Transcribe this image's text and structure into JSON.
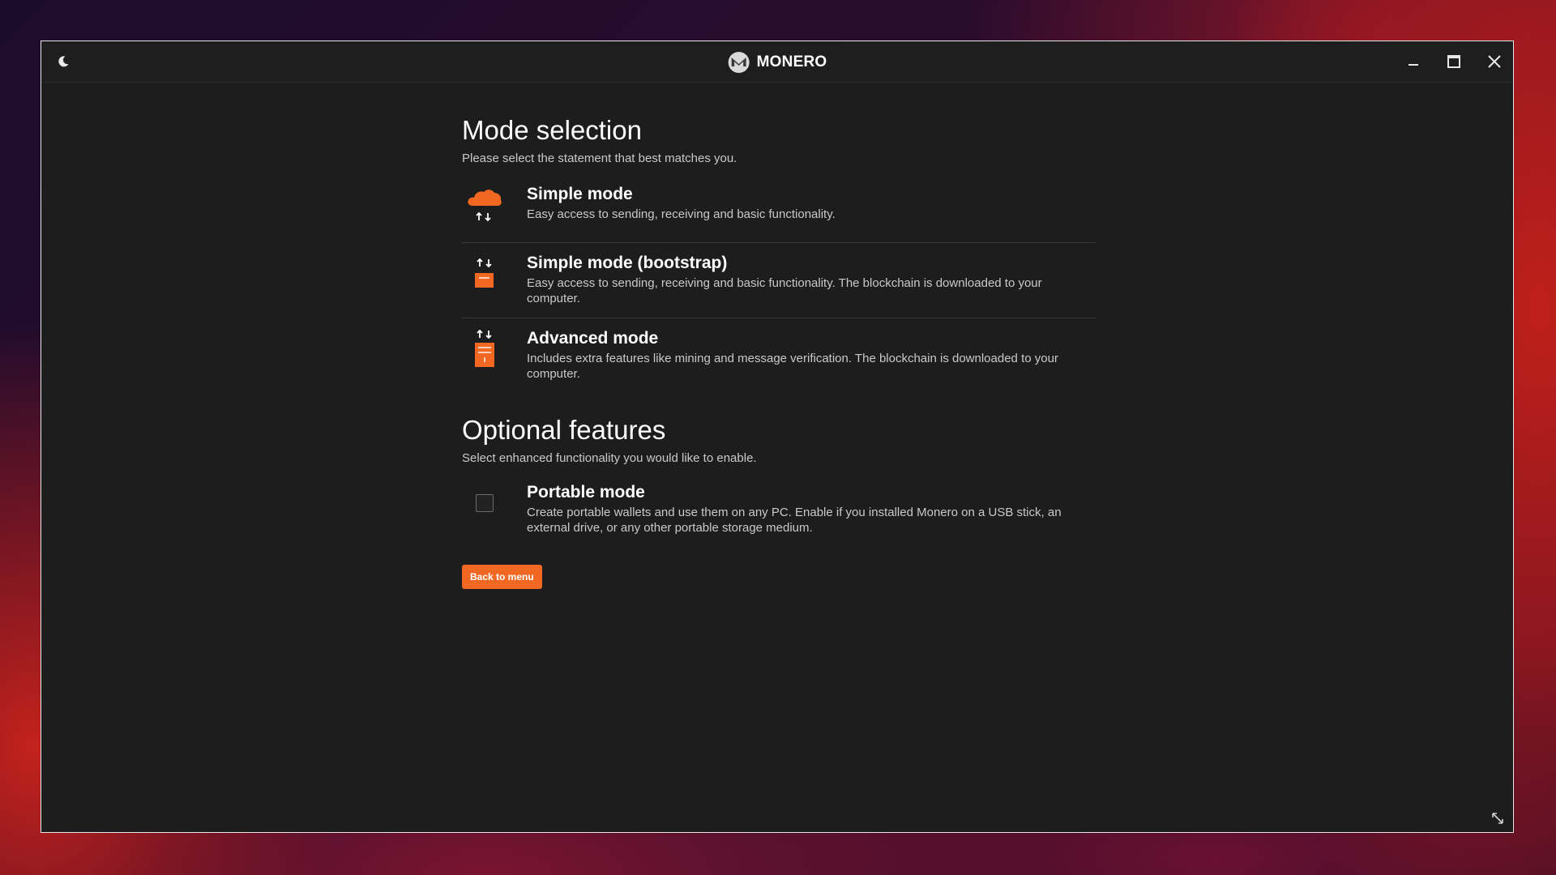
{
  "app": {
    "title": "MONERO",
    "logo_letter": "M"
  },
  "titlebar": {
    "theme_icon": "moon-icon",
    "minimize_icon": "minimize-icon",
    "maximize_icon": "maximize-icon",
    "close_icon": "close-icon"
  },
  "mode_section": {
    "title": "Mode selection",
    "subtitle": "Please select the statement that best matches you.",
    "options": [
      {
        "title": "Simple mode",
        "description": "Easy access to sending, receiving and basic functionality.",
        "icon": "cloud-transfer-icon"
      },
      {
        "title": "Simple mode (bootstrap)",
        "description": "Easy access to sending, receiving and basic functionality. The blockchain is downloaded to your computer.",
        "icon": "transfer-drive-icon"
      },
      {
        "title": "Advanced mode",
        "description": "Includes extra features like mining and message verification. The blockchain is downloaded to your computer.",
        "icon": "transfer-server-icon"
      }
    ]
  },
  "optional_section": {
    "title": "Optional features",
    "subtitle": "Select enhanced functionality you would like to enable.",
    "portable": {
      "title": "Portable mode",
      "description": "Create portable wallets and use them on any PC. Enable if you installed Monero on a USB stick, an external drive, or any other portable storage medium.",
      "checked": false
    }
  },
  "actions": {
    "back_label": "Back to menu"
  },
  "colors": {
    "accent": "#f26822",
    "window_bg": "#1d1d1d",
    "text_primary": "#ffffff",
    "text_secondary": "#c9c9c9"
  }
}
